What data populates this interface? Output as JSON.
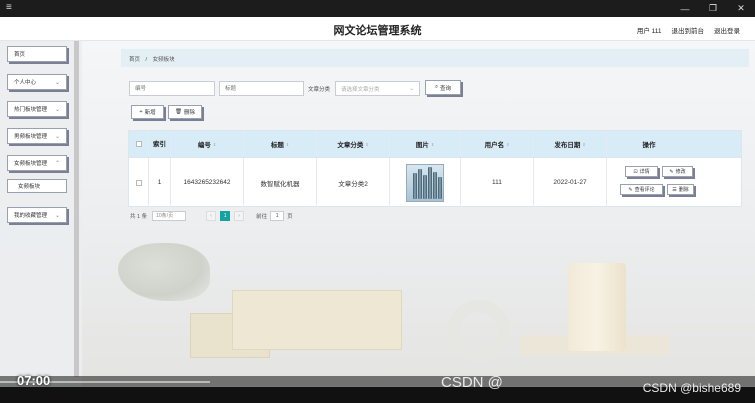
{
  "window": {
    "menu_icon": "hamburger-icon",
    "minimize": "—",
    "restore": "❐",
    "close": "✕"
  },
  "header": {
    "title": "网文论坛管理系统",
    "user": "用户 111",
    "front": "退出到前台",
    "logout": "退出登录"
  },
  "sidebar": {
    "items": [
      {
        "label": "首页",
        "has_chevron": false
      },
      {
        "label": "个人中心",
        "has_chevron": true
      },
      {
        "label": "热门板块管理",
        "has_chevron": true
      },
      {
        "label": "男频板块管理",
        "has_chevron": true
      },
      {
        "label": "女频板块管理",
        "has_chevron": true
      },
      {
        "label": "女频板块",
        "sub": true
      },
      {
        "label": "我的收藏管理",
        "has_chevron": true
      }
    ]
  },
  "breadcrumb": {
    "home": "首页",
    "sep": "/",
    "current": "女频板块"
  },
  "search": {
    "id_placeholder": "编号",
    "title_placeholder": "标题",
    "category_label": "文章分类",
    "category_placeholder": "请选择文章分类",
    "query_button": "查询"
  },
  "actions": {
    "add": "新增",
    "delete": "删除"
  },
  "table": {
    "headers": [
      "",
      "索引",
      "编号",
      "标题",
      "文章分类",
      "图片",
      "用户名",
      "发布日期",
      "操作"
    ],
    "rows": [
      {
        "index": "1",
        "id": "1643265232642",
        "title": "数智赋化机器",
        "category": "文章分类2",
        "username": "111",
        "date": "2022-01-27",
        "ops": {
          "detail": "详情",
          "edit": "修改",
          "comments": "查看评论",
          "delete": "删除"
        }
      }
    ]
  },
  "pagination": {
    "total": "共 1 条",
    "page_size": "10条/页",
    "prev": "‹",
    "current": "1",
    "next": "›",
    "goto": "前往",
    "goto_value": "1",
    "page_unit": "页"
  },
  "video": {
    "time": "07:00"
  },
  "watermarks": {
    "center": "CSDN @",
    "right": "CSDN @bishe689"
  }
}
